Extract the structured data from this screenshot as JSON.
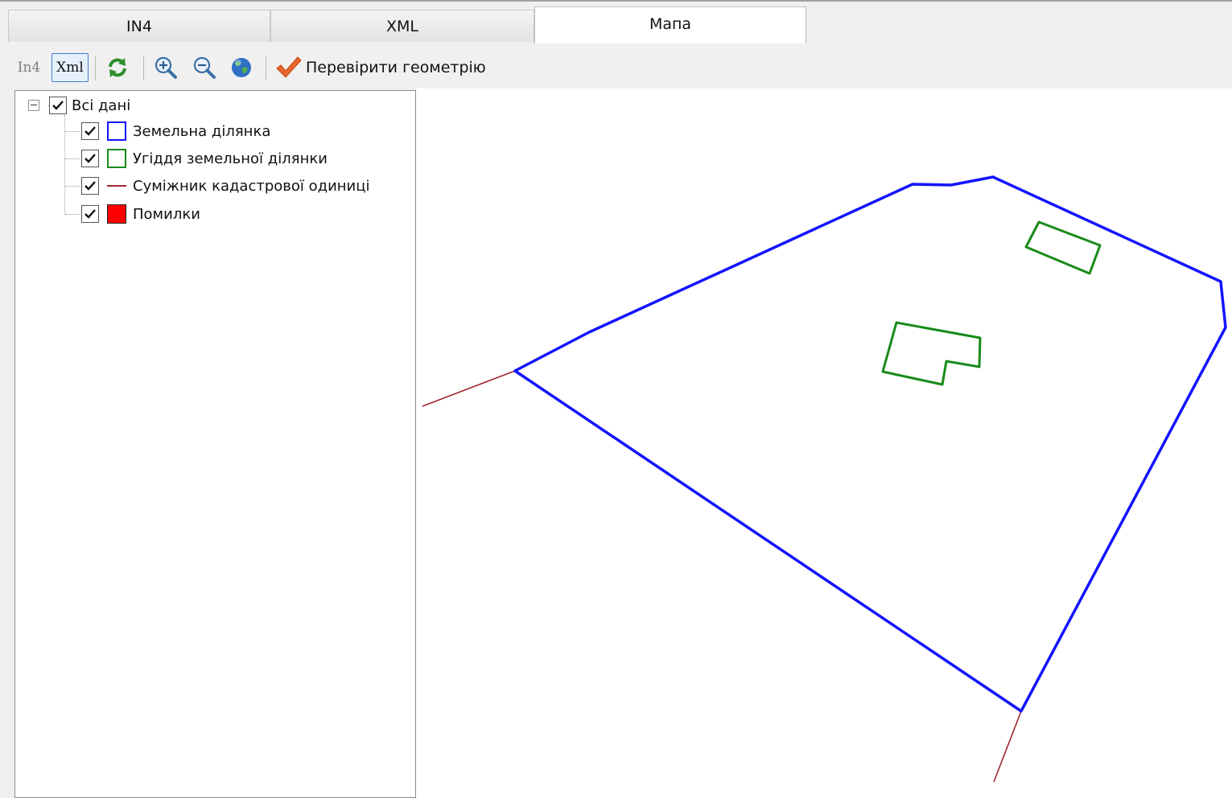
{
  "tabs": [
    {
      "label": "IN4",
      "active": false
    },
    {
      "label": "XML",
      "active": false
    },
    {
      "label": "Мапа",
      "active": true
    }
  ],
  "toolbar": {
    "in4_label": "In4",
    "xml_label": "Xml",
    "check_geometry_label": "Перевірити геометрію",
    "icons": [
      "refresh-icon",
      "zoom-in-icon",
      "zoom-out-icon",
      "globe-icon",
      "checkmark-icon"
    ]
  },
  "layers": {
    "root": {
      "label": "Всі дані",
      "checked": true,
      "expanded": true
    },
    "items": [
      {
        "label": "Земельна ділянка",
        "checked": true,
        "symbol": "square-outline",
        "color": "#1414ff"
      },
      {
        "label": "Угіддя земельної ділянки",
        "checked": true,
        "symbol": "square-outline",
        "color": "#1a8a1a"
      },
      {
        "label": "Суміжник кадастрової одиниці",
        "checked": true,
        "symbol": "line",
        "color": "#a0282d"
      },
      {
        "label": "Помилки",
        "checked": true,
        "symbol": "square-filled",
        "color": "#ff0000"
      }
    ]
  },
  "colors": {
    "parcel": "#1414ff",
    "land_use": "#1a8a1a",
    "neighbor": "#a0282d",
    "errors": "#ff0000"
  }
}
